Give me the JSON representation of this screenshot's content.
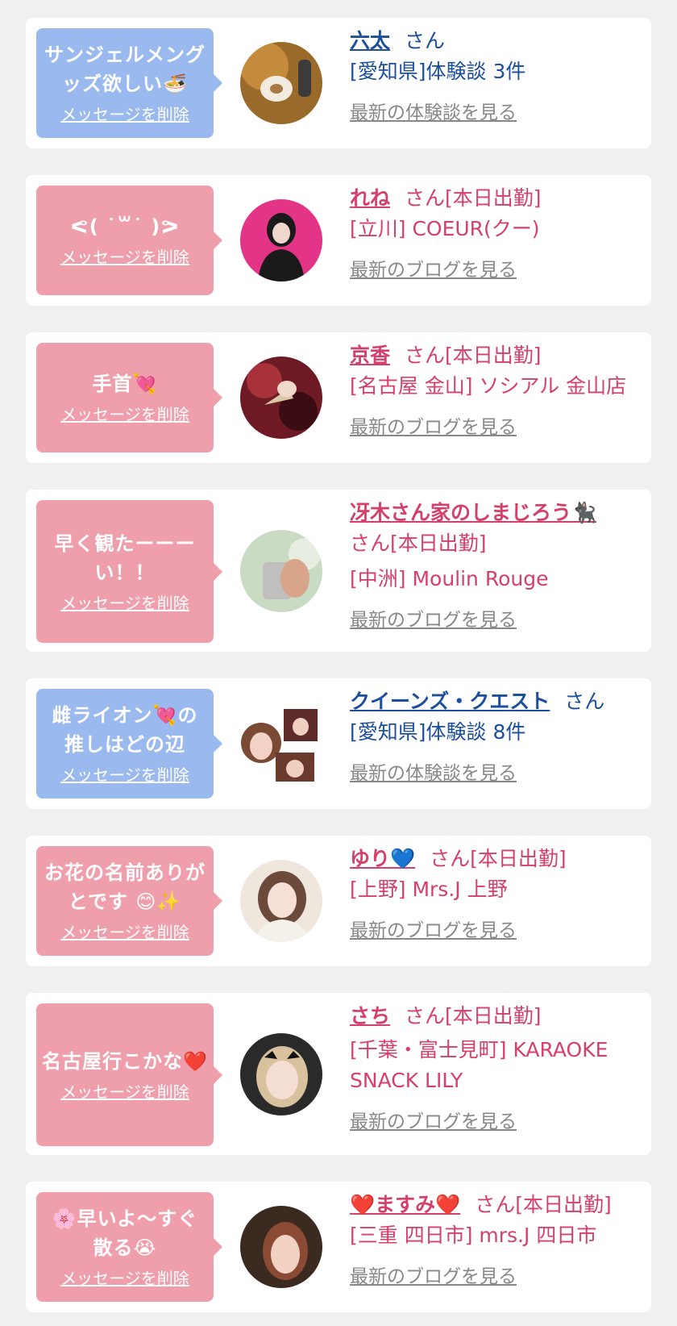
{
  "colors": {
    "blue_bubble": "#99b9ef",
    "pink_bubble": "#ef9fab",
    "blue_text": "#1d4f9c",
    "pink_text": "#d5406b",
    "link_gray": "#888888"
  },
  "delete_label": "メッセージを削除",
  "san": "さん",
  "items": [
    {
      "bubble_color": "blue",
      "message": "サンジェルメングッズ欲しい🍜",
      "name": "六太",
      "suffix": "さん",
      "line1": "[愛知県]体験談 3件",
      "line2": "",
      "link": "最新の体験談を見る"
    },
    {
      "bubble_color": "pink",
      "message": "ᕙ( ˙꒳˙ )ᕗ",
      "name": "れね",
      "suffix": "さん[本日出勤]",
      "line1": "[立川] COEUR(クー)",
      "line2": "",
      "link": "最新のブログを見る"
    },
    {
      "bubble_color": "pink",
      "message": "手首💘",
      "name": "京香",
      "suffix": "さん[本日出勤]",
      "line1": "[名古屋 金山] ソシアル 金山店",
      "line2": "",
      "link": "最新のブログを見る"
    },
    {
      "bubble_color": "pink",
      "message": "早く観たーーーい！！",
      "name": "冴木さん家のしまじろう🐈‍⬛",
      "suffix": "さん[本日出勤]",
      "line1": "[中洲] Moulin Rouge",
      "line2": "",
      "link": "最新のブログを見る"
    },
    {
      "bubble_color": "blue",
      "message": "雌ライオン💘の推しはどの辺",
      "name": "クイーンズ・クエスト",
      "suffix": "さん",
      "line1": "[愛知県]体験談 8件",
      "line2": "",
      "link": "最新の体験談を見る"
    },
    {
      "bubble_color": "pink",
      "message": "お花の名前ありがとです 😊✨",
      "name": "ゆり💙",
      "suffix": "さん[本日出勤]",
      "line1": "[上野] Mrs.J 上野",
      "line2": "",
      "link": "最新のブログを見る"
    },
    {
      "bubble_color": "pink",
      "message": "名古屋行こかな❤️",
      "name": "さち",
      "suffix": "さん[本日出勤]",
      "line1": "[千葉・富士見町] KARAOKE",
      "line2": "SNACK LILY",
      "link": "最新のブログを見る"
    },
    {
      "bubble_color": "pink",
      "message": "🌸早いよ〜すぐ散る😭",
      "name": "❤️ますみ❤️",
      "suffix": "さん[本日出勤]",
      "line1": "[三重 四日市] mrs.J 四日市",
      "line2": "",
      "link": "最新のブログを見る"
    }
  ]
}
